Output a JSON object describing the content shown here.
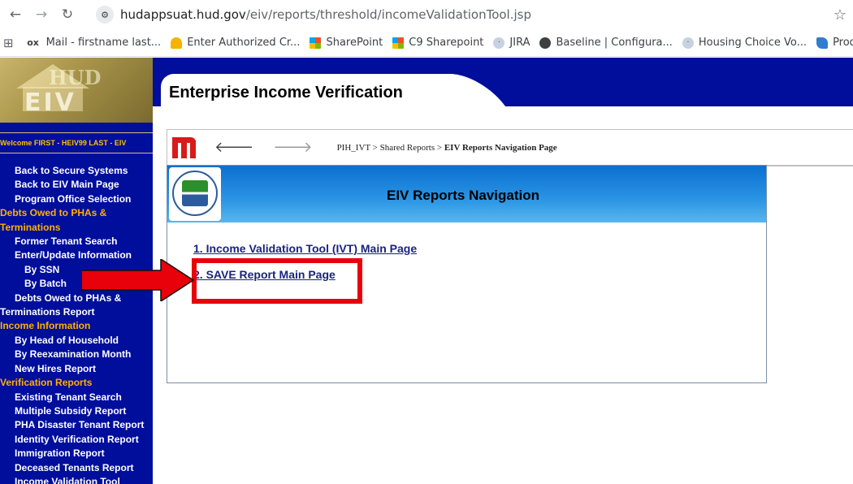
{
  "browser": {
    "url_host": "hudappsuat.hud.gov",
    "url_path": "/eiv/reports/threshold/incomeValidationTool.jsp",
    "bookmarks": [
      {
        "label": "Mail - firstname last..."
      },
      {
        "label": "Enter Authorized Cr..."
      },
      {
        "label": "SharePoint"
      },
      {
        "label": "C9 Sharepoint"
      },
      {
        "label": "JIRA"
      },
      {
        "label": "Baseline | Configura..."
      },
      {
        "label": "Housing Choice Vo..."
      },
      {
        "label": "Product Componen..."
      }
    ]
  },
  "logo": {
    "top_text": "HUD",
    "main_text": "EIV"
  },
  "header": {
    "title": "Enterprise Income Verification"
  },
  "welcome": "Welcome FIRST - HEIV99 LAST - EIV",
  "sidebar": {
    "items": [
      {
        "label": "Back to Secure Systems"
      },
      {
        "label": "Back to EIV Main Page"
      },
      {
        "label": "Program Office Selection"
      },
      {
        "label": "Debts Owed to PHAs &"
      },
      {
        "label": "Terminations"
      },
      {
        "label": "Former Tenant Search"
      },
      {
        "label": "Enter/Update Information"
      },
      {
        "label": "By SSN"
      },
      {
        "label": "By Batch"
      },
      {
        "label": "Debts Owed to PHAs &"
      },
      {
        "label": "Terminations Report"
      },
      {
        "label": "Income Information"
      },
      {
        "label": "By Head of Household"
      },
      {
        "label": "By Reexamination Month"
      },
      {
        "label": "New Hires Report"
      },
      {
        "label": "Verification Reports"
      },
      {
        "label": "Existing Tenant Search"
      },
      {
        "label": "Multiple Subsidy Report"
      },
      {
        "label": "PHA Disaster Tenant Report"
      },
      {
        "label": "Identity Verification Report"
      },
      {
        "label": "Immigration Report"
      },
      {
        "label": "Deceased Tenants Report"
      },
      {
        "label": "Income Validation Tool"
      }
    ]
  },
  "breadcrumb": {
    "path": "PIH_IVT > Shared Reports > ",
    "current": "EIV Reports Navigation Page"
  },
  "panel": {
    "title": "EIV Reports Navigation",
    "links": [
      {
        "label": "1. Income Validation Tool (IVT) Main Page"
      },
      {
        "label": "2. SAVE Report Main Page"
      }
    ]
  },
  "colors": {
    "nav_blue": "#000e9c",
    "section_orange": "#ffb000",
    "highlight_red": "#e8000b",
    "link_blue": "#1a237e"
  }
}
